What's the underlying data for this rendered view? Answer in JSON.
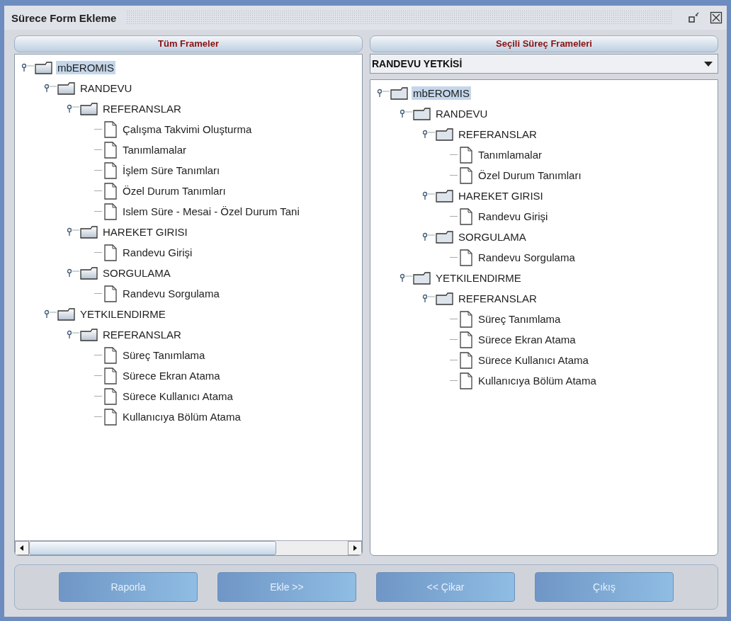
{
  "window": {
    "title": "Sürece Form Ekleme"
  },
  "left_panel": {
    "title": "Tüm Frameler",
    "tree": [
      {
        "label": "mbEROMIS",
        "kind": "folder",
        "expanded": true,
        "selected": true,
        "children": [
          {
            "label": "RANDEVU",
            "kind": "folder",
            "expanded": true,
            "selected": false,
            "children": [
              {
                "label": "REFERANSLAR",
                "kind": "folder",
                "expanded": true,
                "selected": false,
                "children": [
                  {
                    "label": "Çalışma Takvimi Oluşturma",
                    "kind": "leaf",
                    "selected": false
                  },
                  {
                    "label": "Tanımlamalar",
                    "kind": "leaf",
                    "selected": false
                  },
                  {
                    "label": "İşlem Süre Tanımları",
                    "kind": "leaf",
                    "selected": false
                  },
                  {
                    "label": "Özel Durum Tanımları",
                    "kind": "leaf",
                    "selected": false
                  },
                  {
                    "label": "Islem Süre - Mesai - Özel Durum Tani",
                    "kind": "leaf",
                    "selected": false
                  }
                ]
              },
              {
                "label": "HAREKET GIRISI",
                "kind": "folder",
                "expanded": true,
                "selected": false,
                "children": [
                  {
                    "label": "Randevu Girişi",
                    "kind": "leaf",
                    "selected": false
                  }
                ]
              },
              {
                "label": "SORGULAMA",
                "kind": "folder",
                "expanded": true,
                "selected": false,
                "children": [
                  {
                    "label": "Randevu Sorgulama",
                    "kind": "leaf",
                    "selected": false
                  }
                ]
              }
            ]
          },
          {
            "label": "YETKILENDIRME",
            "kind": "folder",
            "expanded": true,
            "selected": false,
            "children": [
              {
                "label": "REFERANSLAR",
                "kind": "folder",
                "expanded": true,
                "selected": false,
                "children": [
                  {
                    "label": "Süreç Tanımlama",
                    "kind": "leaf",
                    "selected": false
                  },
                  {
                    "label": "Sürece Ekran Atama",
                    "kind": "leaf",
                    "selected": false
                  },
                  {
                    "label": "Sürece Kullanıcı Atama",
                    "kind": "leaf",
                    "selected": false
                  },
                  {
                    "label": "Kullanıcıya Bölüm Atama",
                    "kind": "leaf",
                    "selected": false
                  }
                ]
              }
            ]
          }
        ]
      }
    ]
  },
  "right_panel": {
    "title": "Seçili Süreç Frameleri",
    "process_select": {
      "value": "RANDEVU YETKİSİ"
    },
    "tree": [
      {
        "label": "mbEROMIS",
        "kind": "folder",
        "expanded": true,
        "selected": true,
        "children": [
          {
            "label": "RANDEVU",
            "kind": "folder",
            "expanded": true,
            "selected": false,
            "children": [
              {
                "label": "REFERANSLAR",
                "kind": "folder",
                "expanded": true,
                "selected": false,
                "children": [
                  {
                    "label": "Tanımlamalar",
                    "kind": "leaf",
                    "selected": false
                  },
                  {
                    "label": "Özel Durum Tanımları",
                    "kind": "leaf",
                    "selected": false
                  }
                ]
              },
              {
                "label": "HAREKET GIRISI",
                "kind": "folder",
                "expanded": true,
                "selected": false,
                "children": [
                  {
                    "label": "Randevu Girişi",
                    "kind": "leaf",
                    "selected": false
                  }
                ]
              },
              {
                "label": "SORGULAMA",
                "kind": "folder",
                "expanded": true,
                "selected": false,
                "children": [
                  {
                    "label": "Randevu Sorgulama",
                    "kind": "leaf",
                    "selected": false
                  }
                ]
              }
            ]
          },
          {
            "label": "YETKILENDIRME",
            "kind": "folder",
            "expanded": true,
            "selected": false,
            "children": [
              {
                "label": "REFERANSLAR",
                "kind": "folder",
                "expanded": true,
                "selected": false,
                "children": [
                  {
                    "label": "Süreç Tanımlama",
                    "kind": "leaf",
                    "selected": false
                  },
                  {
                    "label": "Sürece Ekran Atama",
                    "kind": "leaf",
                    "selected": false
                  },
                  {
                    "label": "Sürece Kullanıcı Atama",
                    "kind": "leaf",
                    "selected": false
                  },
                  {
                    "label": "Kullanıcıya Bölüm Atama",
                    "kind": "leaf",
                    "selected": false
                  }
                ]
              }
            ]
          }
        ]
      }
    ]
  },
  "buttons": [
    "Raporla",
    "Ekle >>",
    "<< Çikar",
    "Çıkış"
  ]
}
